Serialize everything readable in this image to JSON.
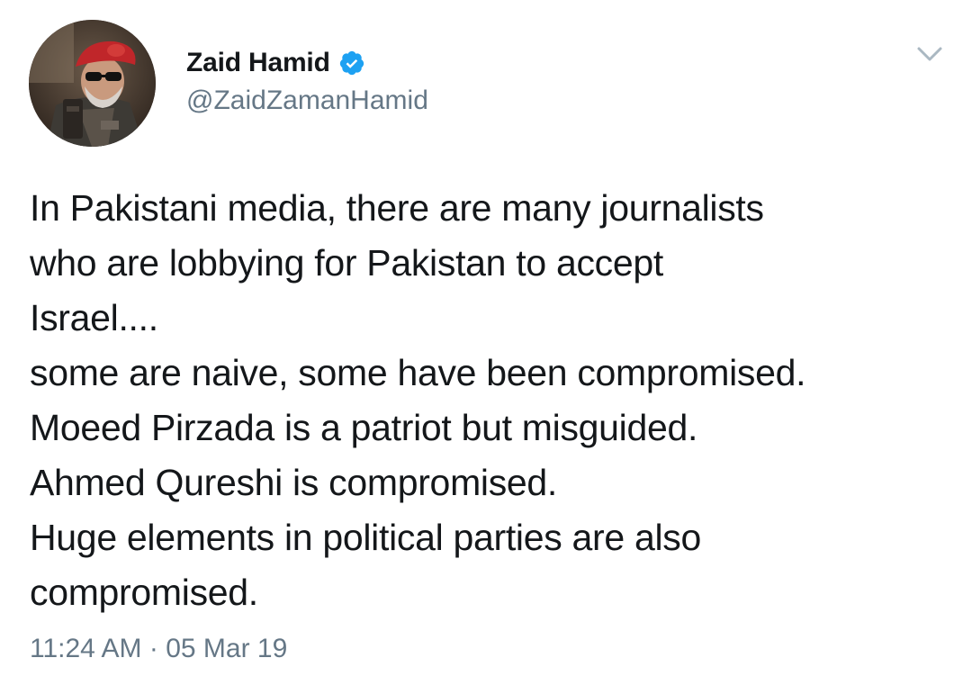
{
  "author": {
    "display_name": "Zaid Hamid",
    "handle": "@ZaidZamanHamid",
    "verified": true
  },
  "icons": {
    "verified": "verified-badge-icon",
    "menu": "chevron-down-icon"
  },
  "tweet": {
    "lines": [
      "In Pakistani media, there are many journalists",
      "who are lobbying for Pakistan to accept",
      "Israel....",
      "some are naive, some have been compromised.",
      "Moeed Pirzada is a patriot but misguided.",
      "Ahmed Qureshi is compromised.",
      "Huge elements in political parties are also",
      "compromised."
    ],
    "time": "11:24 AM",
    "separator": "·",
    "date": "05 Mar 19"
  },
  "colors": {
    "text": "#14171a",
    "secondary": "#657786",
    "verified_blue": "#1da1f2",
    "chevron": "#aab8c2"
  }
}
